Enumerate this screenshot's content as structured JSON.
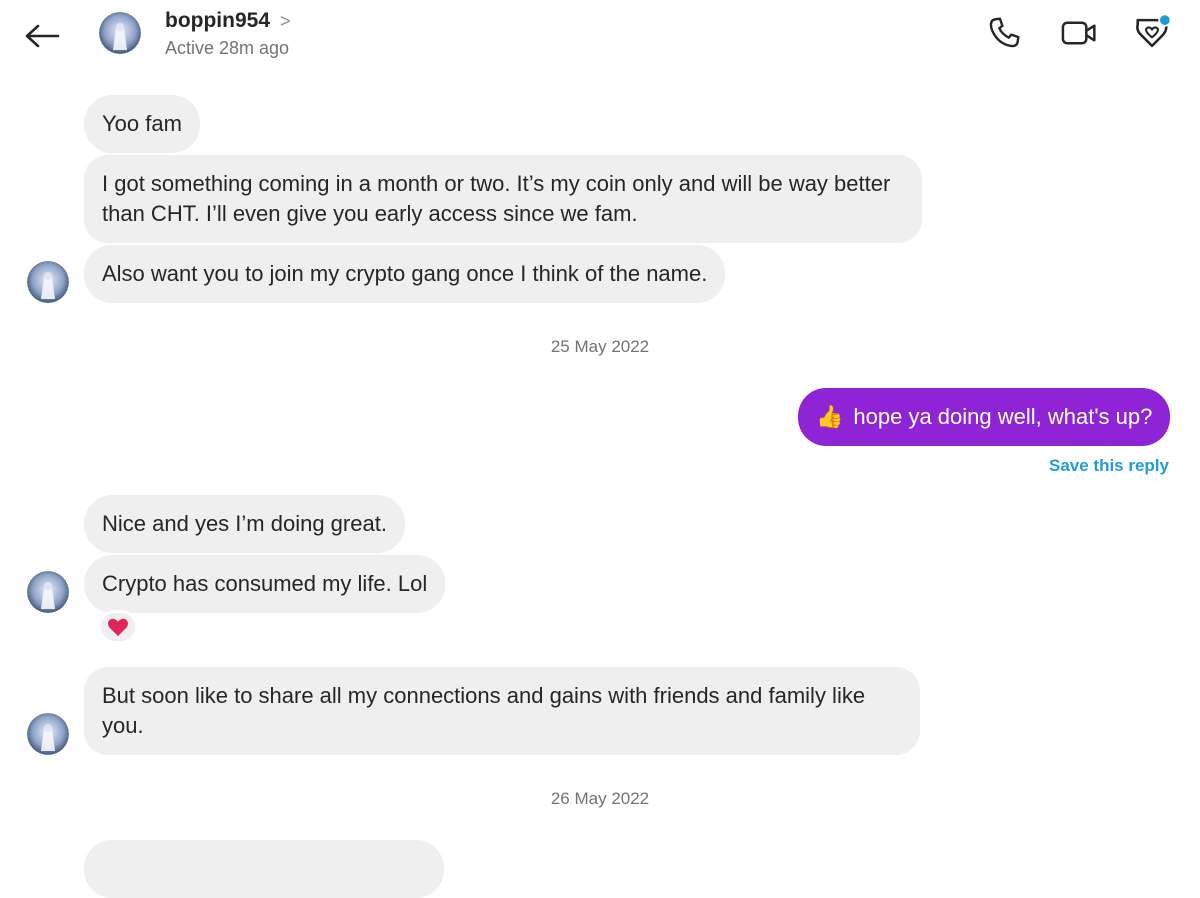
{
  "header": {
    "username": "boppin954",
    "chevron": ">",
    "status": "Active 28m ago",
    "icons": [
      "back-arrow-icon",
      "phone-icon",
      "video-camera-icon",
      "heart-tag-icon"
    ],
    "notification_dot_color": "#1f9cde"
  },
  "messages": {
    "m1": "Yoo fam",
    "m2": "I got something coming in a month or two. It’s my coin only and will be way better than CHT. I’ll even give you early access since we fam.",
    "m3": "Also want you to join my crypto gang once I think of the name.",
    "date1": "25 May 2022",
    "out1_emoji": "👍",
    "out1_text": "hope ya doing well, what's up?",
    "save_reply": "Save this reply",
    "m4": "Nice and yes I’m doing great.",
    "m5": "Crypto has consumed my life. Lol",
    "reaction": "heart",
    "m6": "But soon like to share all my connections and gains with friends and family like you.",
    "date2": "26 May 2022"
  },
  "colors": {
    "incoming_bubble": "#efefef",
    "outgoing_bubble": "#8e24d6",
    "link_blue": "#1f9cde",
    "reaction_heart": "#e0245e"
  }
}
